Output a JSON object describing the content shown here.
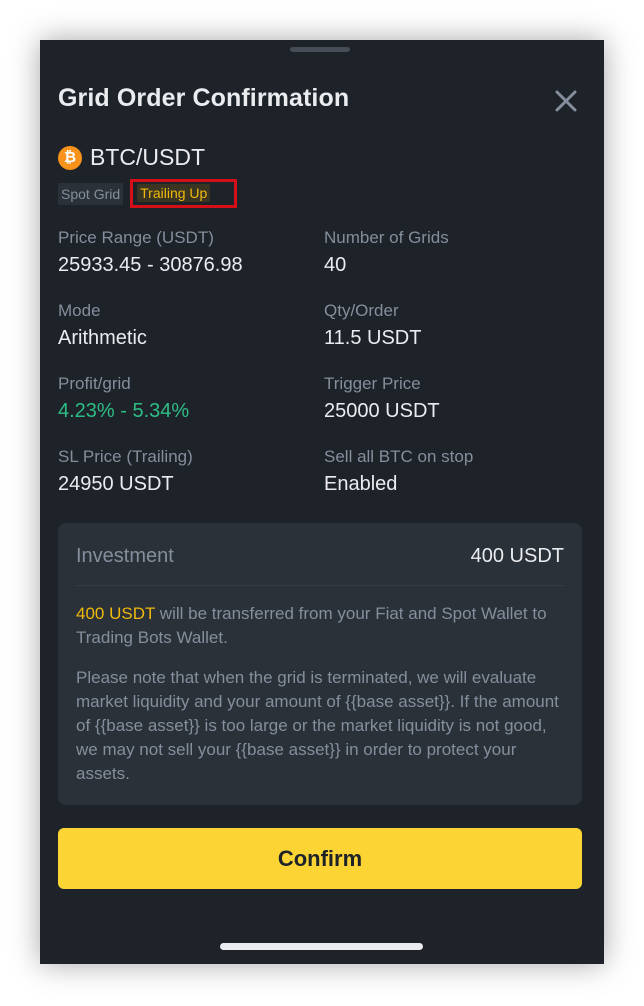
{
  "header": {
    "title": "Grid Order Confirmation",
    "close_icon": "close-icon"
  },
  "pair": {
    "coin_icon": "bitcoin-icon",
    "coin_symbol": "₿",
    "name": "BTC/USDT"
  },
  "tags": {
    "grid_type": "Spot Grid",
    "trailing": "Trailing Up"
  },
  "details": {
    "price_range": {
      "label": "Price Range (USDT)",
      "value": "25933.45 - 30876.98"
    },
    "num_grids": {
      "label": "Number of Grids",
      "value": "40"
    },
    "mode": {
      "label": "Mode",
      "value": "Arithmetic"
    },
    "qty_order": {
      "label": "Qty/Order",
      "value": "11.5 USDT"
    },
    "profit_grid": {
      "label": "Profit/grid",
      "value": "4.23% - 5.34%"
    },
    "trigger_price": {
      "label": "Trigger Price",
      "value": "25000 USDT"
    },
    "sl_price": {
      "label": "SL Price (Trailing)",
      "value": "24950 USDT"
    },
    "sell_all": {
      "label": "Sell all BTC on stop",
      "value": "Enabled"
    }
  },
  "investment": {
    "label": "Investment",
    "value": "400 USDT",
    "transfer_amount": "400 USDT",
    "transfer_text": " will be transferred from your Fiat and Spot Wallet to Trading Bots Wallet.",
    "note": "Please note that when the grid is terminated, we will evaluate market liquidity and your amount of {{base asset}}. If the amount of {{base asset}} is too large or the market liquidity is not good, we may not sell your {{base asset}} in order to protect your assets."
  },
  "actions": {
    "confirm_label": "Confirm"
  },
  "colors": {
    "background": "#1e2329",
    "card": "#2b3139",
    "accent_yellow": "#fcd535",
    "highlight": "#f0b90b",
    "profit_green": "#2ebd85",
    "muted_text": "#848e9c",
    "primary_text": "#eaecef",
    "annotation_red": "#d50f17"
  }
}
